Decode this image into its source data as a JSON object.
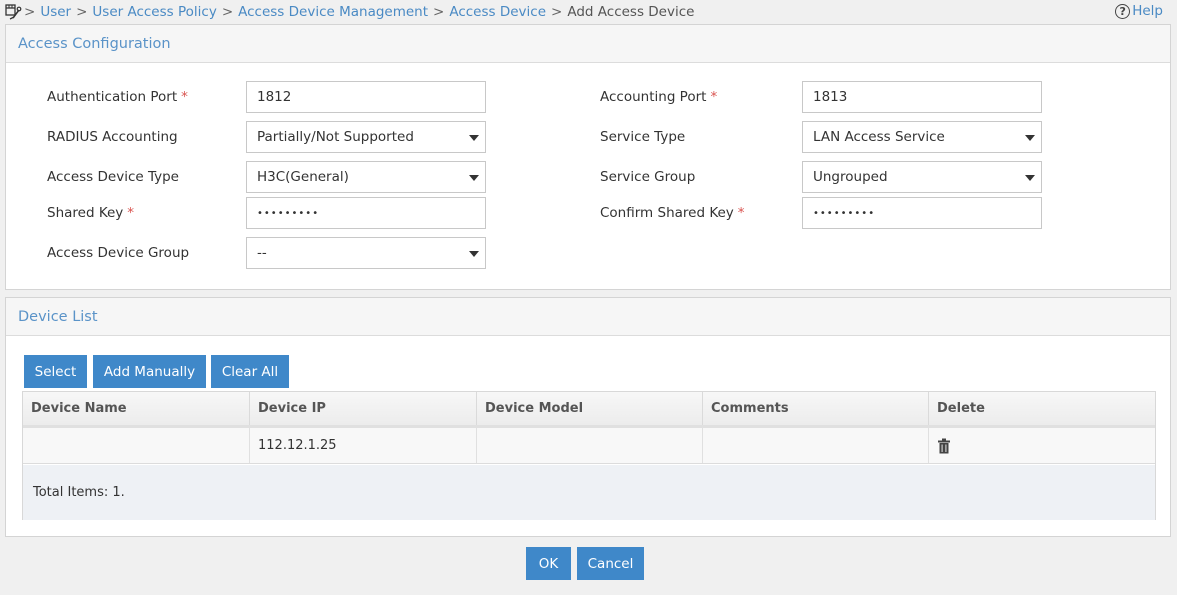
{
  "breadcrumb": {
    "items": [
      {
        "label": "User",
        "link": true
      },
      {
        "label": "User Access Policy",
        "link": true
      },
      {
        "label": "Access Device Management",
        "link": true
      },
      {
        "label": "Access Device",
        "link": true
      },
      {
        "label": "Add Access Device",
        "link": false
      }
    ],
    "separator": ">",
    "help_label": "Help",
    "help_icon": "question-circle-icon"
  },
  "access_config": {
    "title": "Access Configuration",
    "required_mark": "*",
    "fields": {
      "auth_port": {
        "label": "Authentication Port",
        "value": "1812",
        "required": true
      },
      "acct_port": {
        "label": "Accounting Port",
        "value": "1813",
        "required": true
      },
      "radius_accounting": {
        "label": "RADIUS Accounting",
        "value": "Partially/Not Supported"
      },
      "service_type": {
        "label": "Service Type",
        "value": "LAN Access Service"
      },
      "device_type": {
        "label": "Access Device Type",
        "value": "H3C(General)"
      },
      "service_group": {
        "label": "Service Group",
        "value": "Ungrouped"
      },
      "shared_key": {
        "label": "Shared Key",
        "value": "•••••••••",
        "required": true
      },
      "confirm_key": {
        "label": "Confirm Shared Key",
        "value": "•••••••••",
        "required": true
      },
      "device_group": {
        "label": "Access Device Group",
        "value": "--"
      }
    }
  },
  "device_list": {
    "title": "Device List",
    "buttons": {
      "select": "Select",
      "add_manually": "Add Manually",
      "clear_all": "Clear All"
    },
    "columns": [
      "Device Name",
      "Device IP",
      "Device Model",
      "Comments",
      "Delete"
    ],
    "rows": [
      {
        "name": "",
        "ip": "112.12.1.25",
        "model": "",
        "comments": "",
        "delete_icon": "trash-icon"
      }
    ],
    "total": "Total Items: 1."
  },
  "actions": {
    "ok": "OK",
    "cancel": "Cancel"
  },
  "colors": {
    "accent": "#3f88c9",
    "link": "#4a8ac4",
    "required": "#d9534f"
  }
}
